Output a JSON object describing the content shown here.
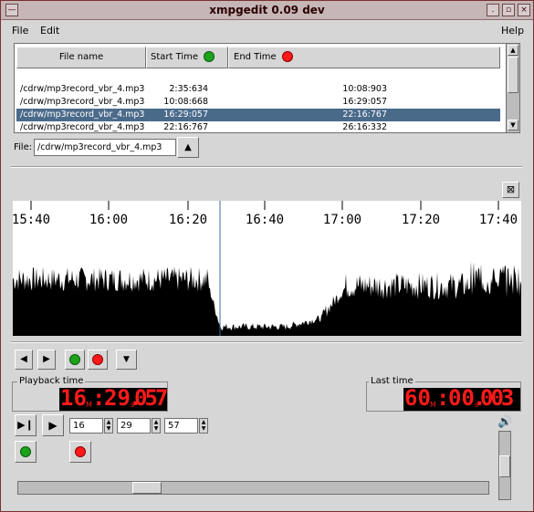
{
  "window": {
    "title": "xmpgedit 0.09 dev"
  },
  "menu": {
    "file": "File",
    "edit": "Edit",
    "help": "Help"
  },
  "filelist": {
    "headers": {
      "file_name": "File name",
      "start_time": "Start Time",
      "end_time": "End Time"
    },
    "rows": [
      {
        "file": "/cdrw/mp3record_vbr_4.mp3",
        "start": "2:35:634",
        "end": "10:08:903",
        "selected": false
      },
      {
        "file": "/cdrw/mp3record_vbr_4.mp3",
        "start": "10:08:668",
        "end": "16:29:057",
        "selected": false
      },
      {
        "file": "/cdrw/mp3record_vbr_4.mp3",
        "start": "16:29:057",
        "end": "22:16:767",
        "selected": true
      },
      {
        "file": "/cdrw/mp3record_vbr_4.mp3",
        "start": "22:16:767",
        "end": "26:16:332",
        "selected": false
      }
    ]
  },
  "file_field": {
    "label": "File:",
    "value": "/cdrw/mp3record_vbr_4.mp3"
  },
  "timeline": {
    "ticks": [
      "15:40",
      "16:00",
      "16:20",
      "16:40",
      "17:00",
      "17:20",
      "17:40"
    ]
  },
  "playback": {
    "label": "Playback time",
    "hours": "16",
    "h_unit": "M",
    "minutes": "29",
    "m_unit": "s",
    "frac": "057"
  },
  "last": {
    "label": "Last time",
    "hours": "60",
    "h_unit": "M",
    "minutes": "00",
    "m_unit": "s",
    "frac": "003"
  },
  "spinners": {
    "minutes": "16",
    "seconds": "29",
    "millis": "57"
  },
  "colors": {
    "green": "#1aa31a",
    "red": "#ff1a1a",
    "selection": "#4a6a8a",
    "lcd_text": "#ff1a1a"
  }
}
